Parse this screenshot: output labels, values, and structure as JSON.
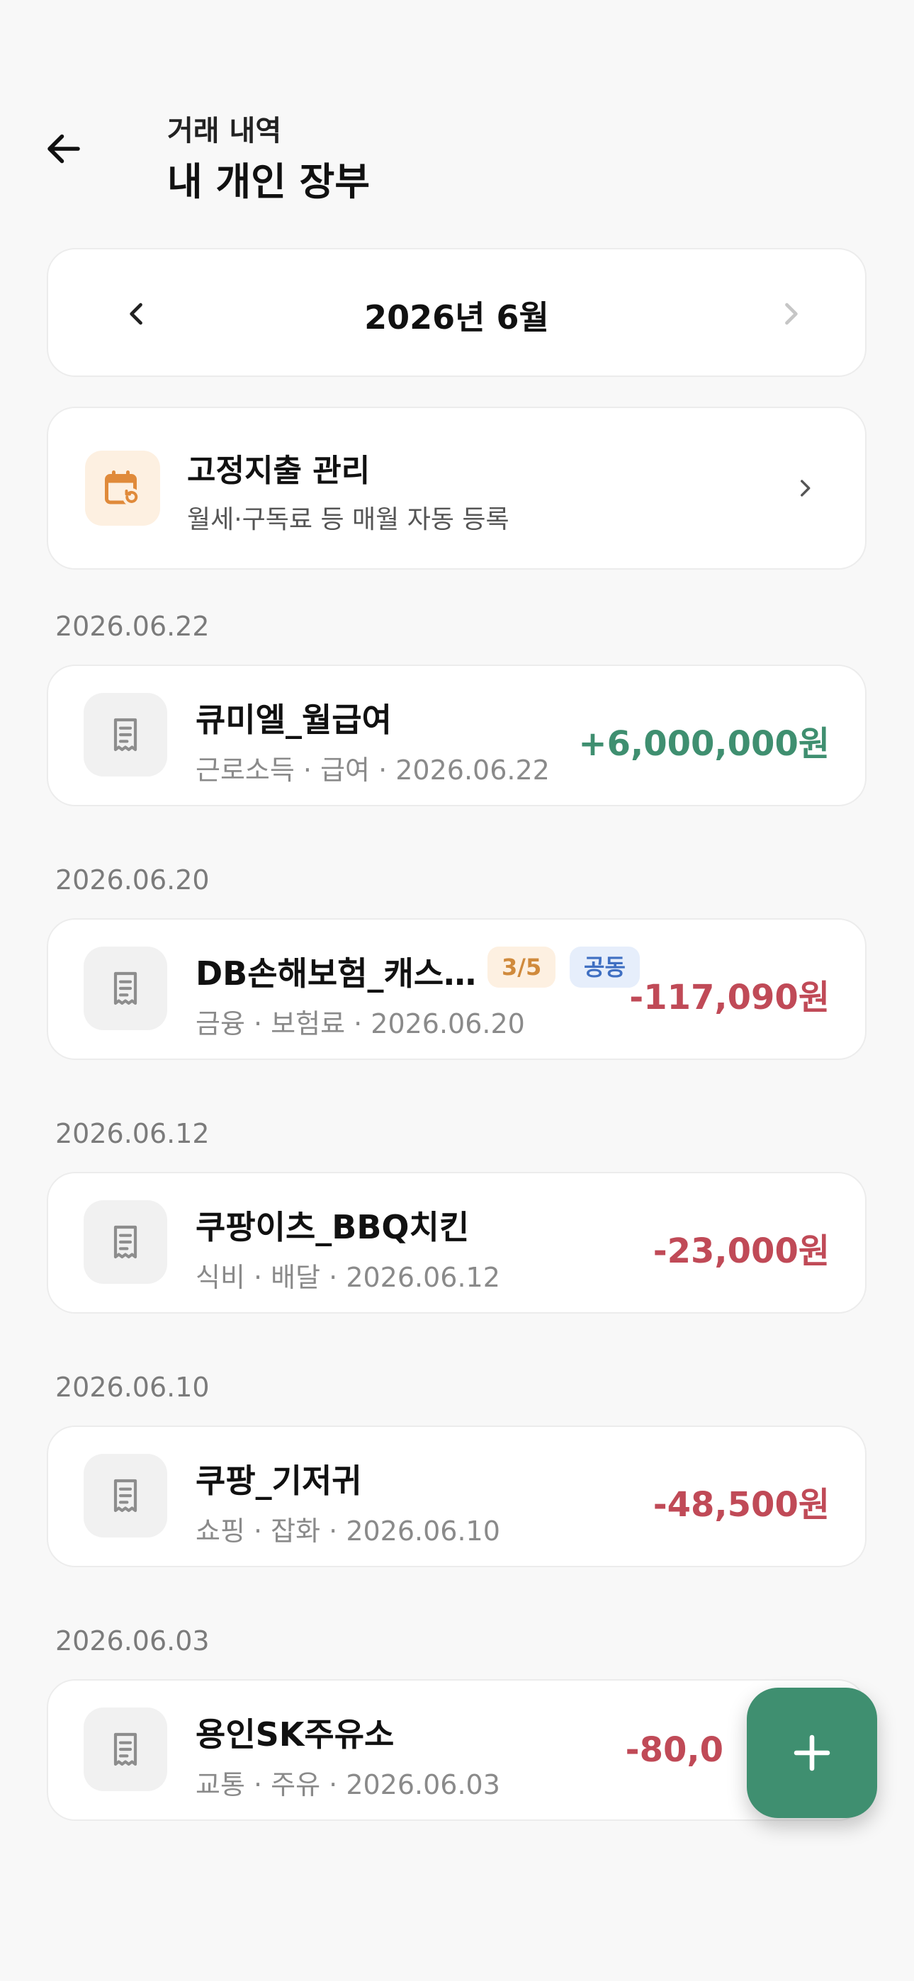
{
  "header": {
    "subtitle": "거래 내역",
    "title": "내 개인 장부"
  },
  "month_nav": {
    "label": "2026년 6월"
  },
  "recurring": {
    "title": "고정지출 관리",
    "description": "월세·구독료 등 매월 자동 등록"
  },
  "groups": [
    {
      "date": "2026.06.22",
      "tx": {
        "name": "큐미엘_월급여",
        "meta": "근로소득 · 급여 · 2026.06.22",
        "amount": "+6,000,000원",
        "type": "income"
      }
    },
    {
      "date": "2026.06.20",
      "tx": {
        "name": "DB손해보험_캐스…",
        "meta": "금융 · 보험료 · 2026.06.20",
        "amount": "-117,090원",
        "type": "expense",
        "badge_count": "3/5",
        "badge_shared": "공동"
      }
    },
    {
      "date": "2026.06.12",
      "tx": {
        "name": "쿠팡이츠_BBQ치킨",
        "meta": "식비 · 배달 · 2026.06.12",
        "amount": "-23,000원",
        "type": "expense"
      }
    },
    {
      "date": "2026.06.10",
      "tx": {
        "name": "쿠팡_기저귀",
        "meta": "쇼핑 · 잡화 · 2026.06.10",
        "amount": "-48,500원",
        "type": "expense"
      }
    },
    {
      "date": "2026.06.03",
      "tx": {
        "name": "용인SK주유소",
        "meta": "교통 · 주유 · 2026.06.03",
        "amount": "-80,0",
        "type": "expense"
      }
    }
  ],
  "colors": {
    "income": "#3f8f70",
    "expense": "#c04a57",
    "accent": "#3f8f70",
    "recurring_icon": "#e08a3a"
  },
  "icons": {
    "back": "arrow-left-icon",
    "prev": "chevron-left-icon",
    "next": "chevron-right-icon",
    "recurring": "calendar-repeat-icon",
    "receipt": "receipt-icon",
    "fab": "plus-icon"
  }
}
